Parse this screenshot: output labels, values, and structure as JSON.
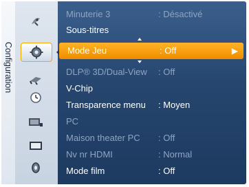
{
  "sidebar": {
    "title": "Configuration",
    "icons": [
      "satellite-dish-icon",
      "setup-gear-icon",
      "input-plug-icon",
      "clock-icon",
      "screen-display-icon",
      "tv-monitor-icon",
      "support-disc-icon"
    ],
    "active_index": 1
  },
  "menu": {
    "items": [
      {
        "label": "Minuterie 3",
        "value": ": Désactivé",
        "state": "dim"
      },
      {
        "label": "Sous-titres",
        "value": "",
        "state": "normal"
      },
      {
        "label": "Mode Jeu",
        "value": ": Off",
        "state": "selected"
      },
      {
        "label": "DLP® 3D/Dual-View",
        "value": ": Off",
        "state": "dim"
      },
      {
        "label": "V-Chip",
        "value": "",
        "state": "normal"
      },
      {
        "label": "Transparence menu",
        "value": ": Moyen",
        "state": "normal"
      },
      {
        "label": "PC",
        "value": "",
        "state": "dim"
      },
      {
        "label": "Maison theater PC",
        "value": ": Off",
        "state": "dim"
      },
      {
        "label": "Nv nr HDMI",
        "value": ": Normal",
        "state": "dim"
      },
      {
        "label": "Mode film",
        "value": ": Off",
        "state": "normal"
      }
    ],
    "selected_arrow": "▶"
  },
  "colors": {
    "panel": "#26466f",
    "highlight": "#f7a21a",
    "dim_text": "#8ea4c2",
    "text": "#ffffff"
  }
}
